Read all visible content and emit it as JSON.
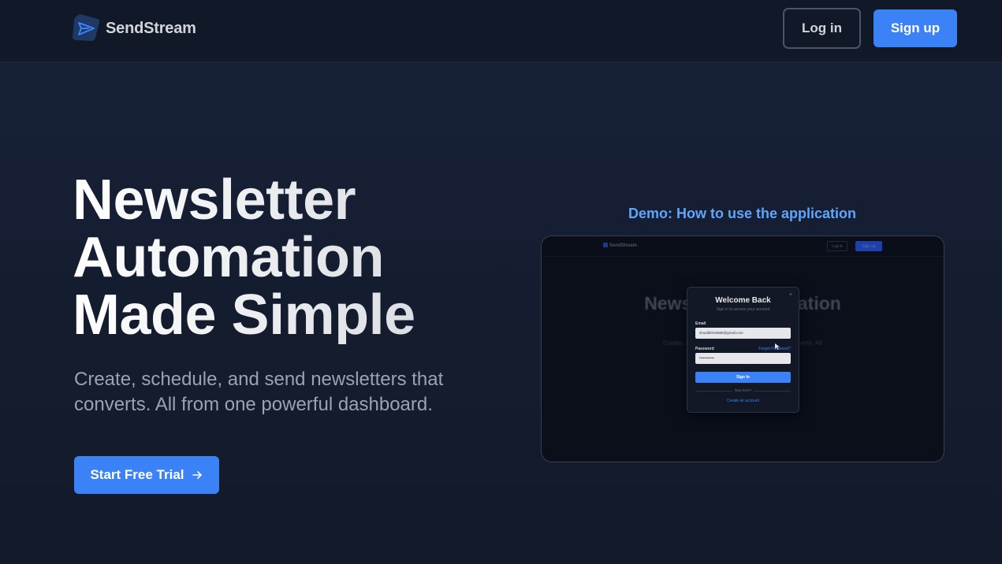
{
  "nav": {
    "brand": "SendStream",
    "login_label": "Log in",
    "signup_label": "Sign up"
  },
  "hero": {
    "title_lines": [
      "Newsletter",
      "Automation",
      "Made Simple"
    ],
    "subtitle": "Create, schedule, and send newsletters that converts. All from one powerful dashboard.",
    "cta_label": "Start Free Trial",
    "cta_icon": "arrow-right-icon"
  },
  "demo": {
    "title": "Demo: How to use the application",
    "video": {
      "nav_brand": "SendStream",
      "nav_login": "Log in",
      "nav_signup": "Sign up",
      "bg_title": "Newsletter Automation Made Simple",
      "bg_subtitle": "Create, schedule, and send newsletters that converts. All",
      "modal": {
        "close": "×",
        "title": "Welcome Back",
        "subtitle": "Sign in to access your account",
        "email_label": "Email",
        "email_value": "shoaibkhn6985@gmail.com",
        "password_label": "Password",
        "forgot_label": "Forgot Password?",
        "password_value": "••••••••••••",
        "signin_label": "Sign In",
        "new_here": "New here?",
        "create_label": "Create an account"
      }
    }
  },
  "colors": {
    "accent": "#3b82f6",
    "accent_light": "#60a5fa",
    "nav_bg": "#111827",
    "page_bg": "#141c2e"
  }
}
